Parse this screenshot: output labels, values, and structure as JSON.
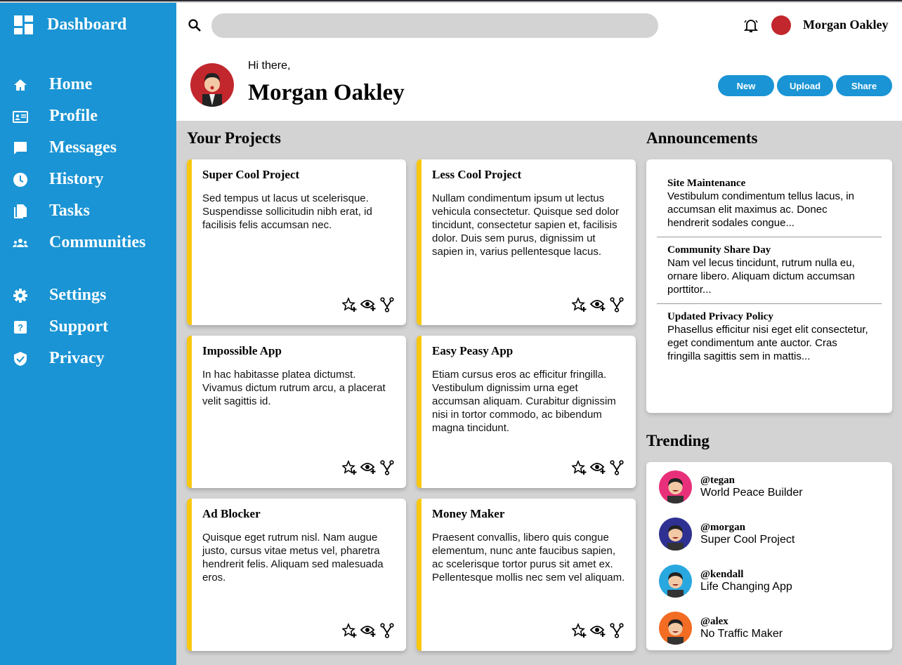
{
  "sidebar": {
    "title": "Dashboard",
    "items": [
      {
        "label": "Home",
        "icon": "home-icon"
      },
      {
        "label": "Profile",
        "icon": "id-card-icon"
      },
      {
        "label": "Messages",
        "icon": "message-icon"
      },
      {
        "label": "History",
        "icon": "clock-icon"
      },
      {
        "label": "Tasks",
        "icon": "document-icon"
      },
      {
        "label": "Communities",
        "icon": "group-icon"
      },
      {
        "label": "Settings",
        "icon": "gear-icon"
      },
      {
        "label": "Support",
        "icon": "help-icon"
      },
      {
        "label": "Privacy",
        "icon": "shield-icon"
      }
    ]
  },
  "topbar": {
    "search_value": "",
    "user_name": "Morgan Oakley"
  },
  "greeting": {
    "hi": "Hi there,",
    "name": "Morgan Oakley"
  },
  "buttons": {
    "new": "New",
    "upload": "Upload",
    "share": "Share"
  },
  "projects": {
    "title": "Your Projects",
    "items": [
      {
        "title": "Super Cool Project",
        "desc": "Sed tempus ut lacus ut scelerisque. Suspendisse sollicitudin nibh erat, id facilisis felis accumsan nec."
      },
      {
        "title": "Less Cool Project",
        "desc": "Nullam condimentum ipsum ut lectus vehicula consectetur. Quisque sed dolor tincidunt, consectetur sapien et, facilisis dolor. Duis sem purus, dignissim ut sapien in, varius pellentesque lacus."
      },
      {
        "title": "Impossible App",
        "desc": "In hac habitasse platea dictumst. Vivamus dictum rutrum arcu, a placerat velit sagittis id."
      },
      {
        "title": "Easy Peasy App",
        "desc": "Etiam cursus eros ac efficitur fringilla. Vestibulum dignissim urna eget accumsan aliquam. Curabitur dignissim nisi in tortor commodo, ac bibendum magna tincidunt."
      },
      {
        "title": "Ad Blocker",
        "desc": "Quisque eget rutrum nisl. Nam augue justo, cursus vitae metus vel, pharetra hendrerit felis. Aliquam sed malesuada eros."
      },
      {
        "title": "Money Maker",
        "desc": "Praesent convallis, libero quis congue elementum, nunc ante faucibus sapien, ac scelerisque tortor purus sit amet ex. Pellentesque mollis nec sem vel aliquam."
      }
    ]
  },
  "announcements": {
    "title": "Announcements",
    "items": [
      {
        "title": "Site Maintenance",
        "desc": "Vestibulum condimentum tellus lacus, in accumsan elit maximus ac. Donec hendrerit sodales congue..."
      },
      {
        "title": "Community Share Day",
        "desc": "Nam vel lecus tincidunt, rutrum nulla eu, ornare libero. Aliquam dictum accumsan porttitor..."
      },
      {
        "title": "Updated Privacy Policy",
        "desc": "Phasellus efficitur nisi eget elit consectetur, eget condimentum ante auctor. Cras fringilla sagittis sem in mattis..."
      }
    ]
  },
  "trending": {
    "title": "Trending",
    "items": [
      {
        "handle": "@tegan",
        "project": "World Peace Builder",
        "color": "#e8307a"
      },
      {
        "handle": "@morgan",
        "project": "Super Cool Project",
        "color": "#2e3192"
      },
      {
        "handle": "@kendall",
        "project": "Life Changing App",
        "color": "#29a8e0"
      },
      {
        "handle": "@alex",
        "project": "No Traffic Maker",
        "color": "#f26c23"
      }
    ]
  },
  "colors": {
    "accent": "#1a94d4",
    "card_stripe": "#f9c80e",
    "background": "#d3d3d3"
  }
}
